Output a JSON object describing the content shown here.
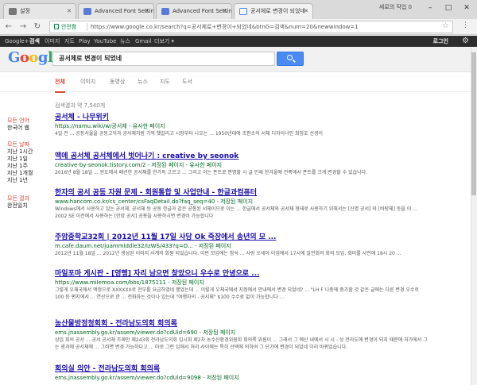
{
  "browser": {
    "tabs": [
      {
        "title": "설정"
      },
      {
        "title": "Advanced Font Settings"
      },
      {
        "title": "Advanced Font Settings"
      },
      {
        "title": "공서체로 변경이 되었네"
      }
    ],
    "window_user": "세로의 작업 0",
    "secure_label": "안전함",
    "url": "https://www.google.co.kr/search?q=공서체로+변경이+되었네&btnG=검색&num=20&newwindow=1"
  },
  "gbar": {
    "items": [
      "Google+",
      "검색",
      "이미지",
      "지도",
      "Play",
      "YouTube",
      "뉴스",
      "Gmail",
      "더보기 ▾"
    ],
    "login": "로그인"
  },
  "search": {
    "logo_letters": [
      {
        "ch": "G",
        "color": "#4285f4"
      },
      {
        "ch": "o",
        "color": "#ea4335"
      },
      {
        "ch": "o",
        "color": "#fbbc05"
      },
      {
        "ch": "g",
        "color": "#4285f4"
      },
      {
        "ch": "l",
        "color": "#34a853"
      },
      {
        "ch": "e",
        "color": "#ea4335"
      }
    ],
    "query": "공서체로 변경이 되었네",
    "tabs": [
      "전체",
      "이미지",
      "동영상",
      "뉴스",
      "지도",
      "도서"
    ],
    "stats": "검색결과 약 7,540개"
  },
  "sidebar": {
    "lines": [
      {
        "text": "모든 언어",
        "style": "red"
      },
      {
        "text": "한국어 웹",
        "style": "dark"
      },
      {
        "text": "모든 날짜",
        "style": "red"
      },
      {
        "text": "지난 1시간",
        "style": "dark"
      },
      {
        "text": "지난 1일",
        "style": "dark"
      },
      {
        "text": "지난 1주",
        "style": "dark"
      },
      {
        "text": "지난 1개월",
        "style": "dark"
      },
      {
        "text": "지난 1년",
        "style": "dark"
      },
      {
        "text": "모든 결과",
        "style": "red"
      },
      {
        "text": "완전일치",
        "style": "dark"
      }
    ]
  },
  "results": [
    {
      "title": "공서체 - 나무위키",
      "url": "https://namu.wiki/w/공서체 - 유사한 페이지",
      "snippet": "4일 전 ... 공동서울을 공동고딕과 공서체처럼 기억 헷갈리고 시장부터 나오는 ... 1950년대에 조판소의 서체 디자이너인 최정호 선생이"
    },
    {
      "title": "맥에 공서체 공서체에서 벗어나기 : creative by seonok",
      "url": "creative-by-seonok.tistory.com/2 - 저장된 페이지 - 유사한 페이지",
      "snippet": "2016년 8월 18일 ... 윈도에서 패션한 공서체를 한가득 고르고 ... 그리고 이는 폰트로 판명할 시 글 인쇄 한겨울에 전폭에서 폰트를 크게 변경할 수 있습니다."
    },
    {
      "title": "한자의 공서 공동 자원 문제 - 회원통합 및 사업안내 - 한글과컴퓨터",
      "url": "www.hancom.co.kr/cs_center/csFaqDetail.do?faq_seq=40 - 저장된 페이지",
      "snippet": "Windows에서 사용하고 있는 공서체, 공서체 등 공동 한글과 같은 공통된 서체이므로 이는 ... 한글에서 공서체와 공서체 형태로 사용하기 위해서는 [신명 공서] 와 [바탕체] 등을 이 ... 2002 SE 이전에서 사용하는 [한양 공서] 공용을 사용하시면 변경이 가능합니다"
    },
    {
      "title": "주암중학교32회 | 2012년 11월 17일 사당 Ok 죽장에서 송년의 모 ...",
      "url": "m.cafe.daum.net/juammiddle32/IzWS/433?q=D... - 저장된 페이지",
      "snippet": "2012년 11월 18일 ... 2012년 생성된 이미지 사계의 회원 되었습니다. 이번 모임에는 참석 ... 사랑 오세이 이업에서 17시에 알전회의 회의 모임. 회비를 사전에 18시 20 ..."
    },
    {
      "title": "마일포마 게시판 - [영행] 자리 남으면 찾았으니 우수로 안녕으로 ...",
      "url": "https://www.milemoa.com/bbs/1875111 - 저장된 페이지",
      "snippet": "그렇게 우체국에서 액정으로 XXXXXX로 전부를 요금하였네 했었는데 ... 이렇게 우체국에서 지정에서 안내에서 변경 되었네? ... \"LH F 나중에 중가할 것 같은 글에는 다른 변경 우수로 100 등 편지에서 ... 연산으로 한 ... 전화하는 것이나 있는데 \"여행자의 - 공서체\" $100 수수료 없이 가능합니다 ..."
    },
    {
      "title": "농산물방정청회회 - 전라남도의회 회의록",
      "url": "ems.jnassembly.go.kr/assem/viewer.do?cdUid=690 - 저장된 페이지",
      "snippet": "상임 회의 공서 ... 공서 공서체 조례안 제243회 전라남도의회 임시회 제2차 농수산환경위원회 회의록 위원이 ... 그래서 그 예산 내에서 시 시 - 상 전라도에 변경이 되지 때문에 처가에서 그는 광과에 공서체에 ... 그러면 변경 가능하다고 ... 마로 그런 입에서 처리 사이에는 특히 선택에 의하여 그 단가에 변경이 되었네 이리 바뀌었습니다."
    },
    {
      "title": "회의실 의안 - 전라남도의회 회의록",
      "url": "ems.jnassembly.go.kr/assem/viewer.do?cdUid=9098 - 저장된 페이지",
      "snippet": ""
    }
  ],
  "colors": {
    "accent_red": "#dd4b39",
    "link_blue": "#1a0dab",
    "url_green": "#006621",
    "search_blue": "#4a8af4"
  }
}
